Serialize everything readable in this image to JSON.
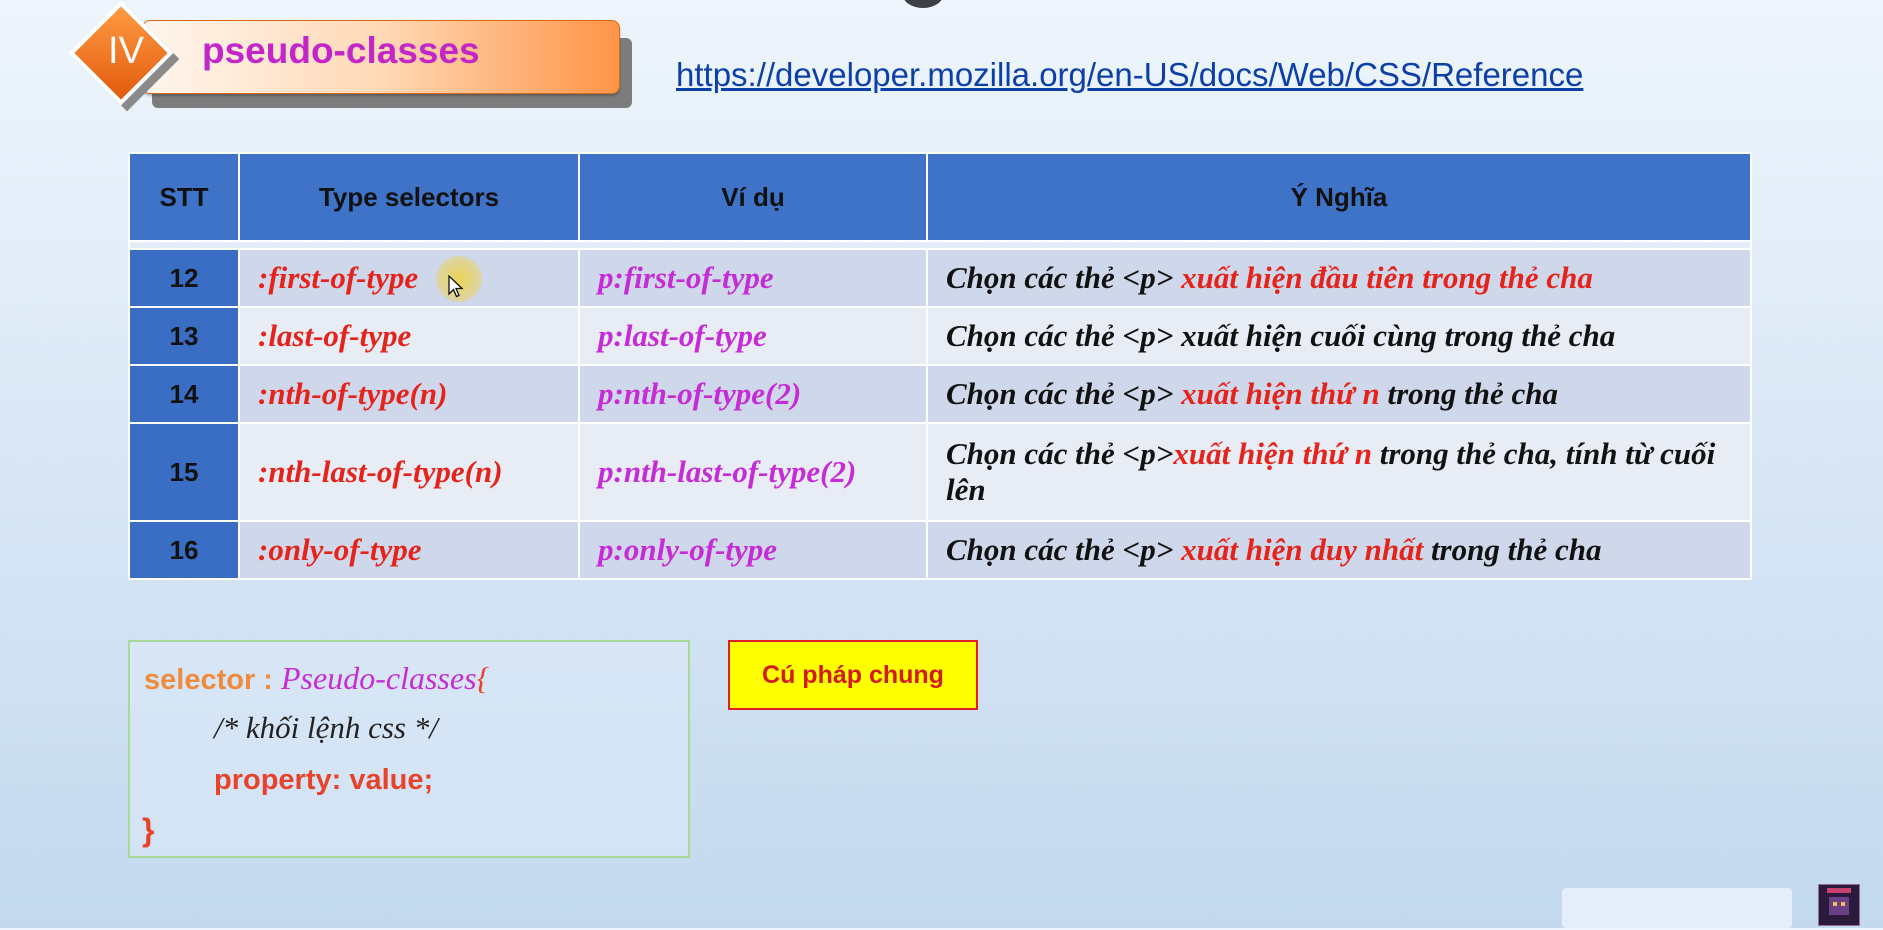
{
  "section": {
    "number": "IV",
    "title": "pseudo-classes"
  },
  "reference_link": "https://developer.mozilla.org/en-US/docs/Web/CSS/Reference",
  "table": {
    "headers": [
      "STT",
      "Type selectors",
      "Ví dụ",
      "Ý Nghĩa"
    ],
    "rows": [
      {
        "stt": "12",
        "selector": ":first-of-type",
        "example": "p:first-of-type",
        "meaning": {
          "black": "Chọn các thẻ <p> ",
          "red": "xuất hiện đầu tiên trong thẻ cha",
          "tail": ""
        }
      },
      {
        "stt": "13",
        "selector": ":last-of-type",
        "example": "p:last-of-type",
        "meaning": {
          "black": "Chọn các thẻ <p> xuất hiện cuối cùng trong thẻ cha",
          "red": "",
          "tail": ""
        }
      },
      {
        "stt": "14",
        "selector": ":nth-of-type(n)",
        "example": "p:nth-of-type(2)",
        "meaning": {
          "black": "Chọn các thẻ <p> ",
          "red": "xuất hiện thứ n",
          "tail": " trong thẻ cha"
        }
      },
      {
        "stt": "15",
        "selector": ":nth-last-of-type(n)",
        "example": "p:nth-last-of-type(2)",
        "meaning": {
          "black": "Chọn các thẻ <p>",
          "red": "xuất hiện thứ n",
          "tail": " trong thẻ cha, tính từ cuối lên"
        }
      },
      {
        "stt": "16",
        "selector": ":only-of-type",
        "example": "p:only-of-type",
        "meaning": {
          "black": "Chọn các thẻ <p> ",
          "red": "xuất hiện  duy nhất",
          "tail": " trong thẻ cha"
        }
      }
    ]
  },
  "syntax": {
    "selector": "selector : ",
    "pseudo": "Pseudo-classes",
    "open_brace": "{",
    "comment": "/* khối lệnh css */",
    "property": "property: value;",
    "close_brace": "}"
  },
  "syntax_button": "Cú pháp chung",
  "colors": {
    "header_blue": "#3e73c8",
    "accent_red": "#e5231b",
    "accent_magenta": "#c52bd6",
    "badge_orange": "#ff9448"
  }
}
